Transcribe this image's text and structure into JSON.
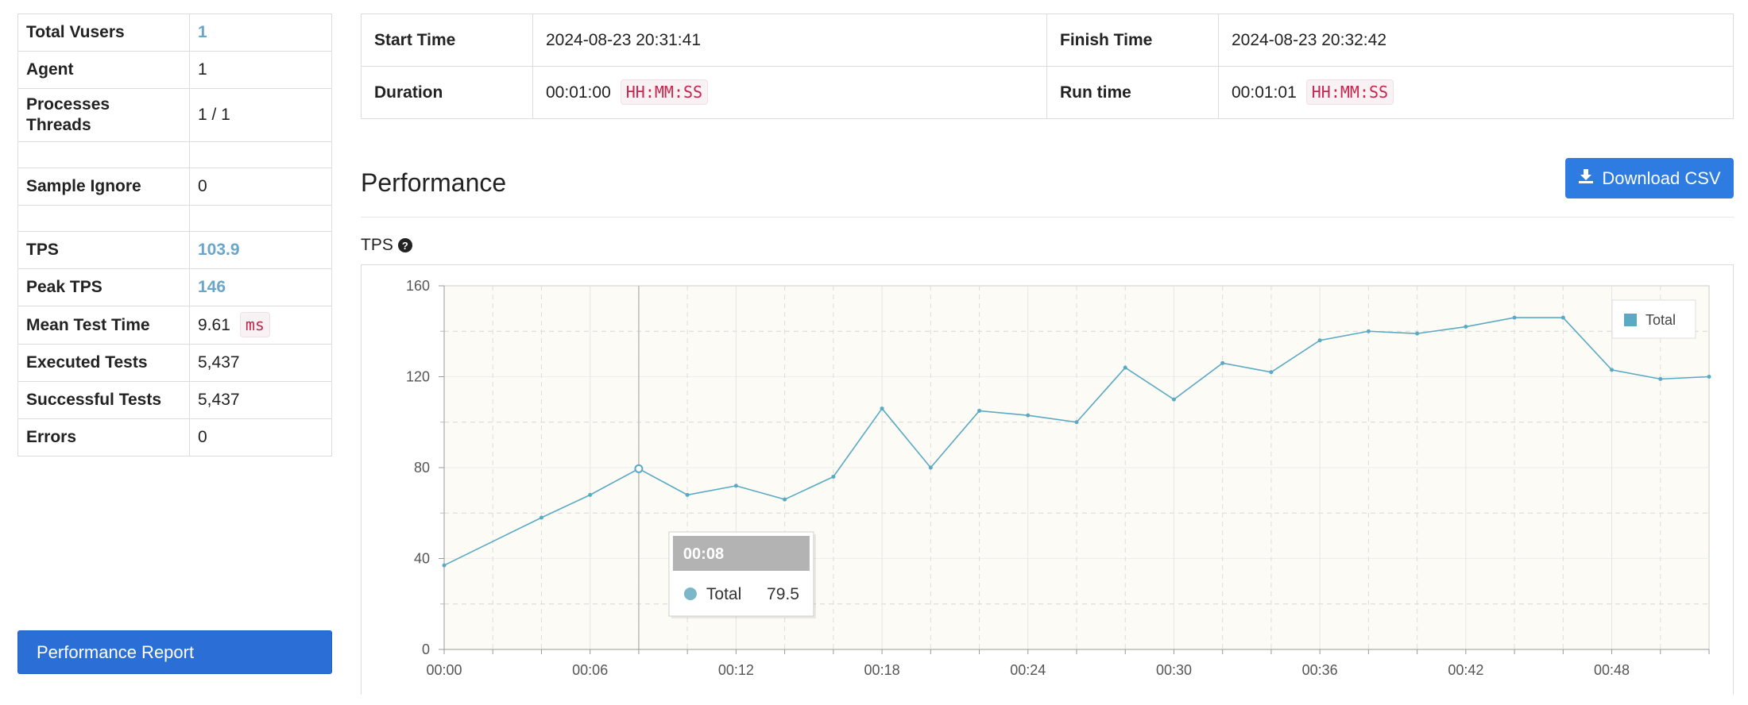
{
  "stats": {
    "total_vusers": {
      "label": "Total Vusers",
      "value": "1"
    },
    "agent": {
      "label": "Agent",
      "value": "1"
    },
    "processes_threads": {
      "label1": "Processes",
      "label2": "Threads",
      "value": "1 / 1"
    },
    "sample_ignore": {
      "label": "Sample Ignore",
      "value": "0"
    },
    "tps": {
      "label": "TPS",
      "value": "103.9"
    },
    "peak_tps": {
      "label": "Peak TPS",
      "value": "146"
    },
    "mean_test_time": {
      "label": "Mean Test Time",
      "value": "9.61",
      "unit": "ms"
    },
    "executed_tests": {
      "label": "Executed Tests",
      "value": "5,437"
    },
    "successful_tests": {
      "label": "Successful Tests",
      "value": "5,437"
    },
    "errors": {
      "label": "Errors",
      "value": "0"
    }
  },
  "report_button": "Performance Report",
  "times": {
    "start_label": "Start Time",
    "start_value": "2024-08-23 20:31:41",
    "finish_label": "Finish Time",
    "finish_value": "2024-08-23 20:32:42",
    "duration_label": "Duration",
    "duration_value": "00:01:00",
    "duration_format": "HH:MM:SS",
    "runtime_label": "Run time",
    "runtime_value": "00:01:01",
    "runtime_format": "HH:MM:SS"
  },
  "section_title": "Performance",
  "download_button": "Download CSV",
  "chart_title": "TPS",
  "colors": {
    "series": "#5aaac4",
    "plot_bg": "#fcfbf5",
    "button": "#2e7be2"
  },
  "tooltip": {
    "time": "00:08",
    "series": "Total",
    "value": "79.5"
  },
  "chart_data": {
    "type": "line",
    "title": "TPS",
    "xlabel": "",
    "ylabel": "",
    "ylim": [
      0,
      160
    ],
    "yticks": [
      0,
      40,
      80,
      120,
      160
    ],
    "xticks": [
      "00:00",
      "00:06",
      "00:12",
      "00:18",
      "00:24",
      "00:30",
      "00:36",
      "00:42",
      "00:48"
    ],
    "legend": "top-right",
    "grid": true,
    "x": [
      0,
      4,
      6,
      8,
      10,
      12,
      14,
      16,
      18,
      20,
      22,
      24,
      26,
      28,
      30,
      32,
      34,
      36,
      38,
      40,
      42,
      44,
      46,
      48,
      50,
      52
    ],
    "series": [
      {
        "name": "Total",
        "values": [
          37,
          58,
          68,
          79.5,
          68,
          72,
          66,
          76,
          106,
          80,
          105,
          103,
          100,
          124,
          110,
          126,
          122,
          136,
          140,
          139,
          142,
          146,
          146,
          123,
          119,
          120
        ]
      }
    ]
  }
}
